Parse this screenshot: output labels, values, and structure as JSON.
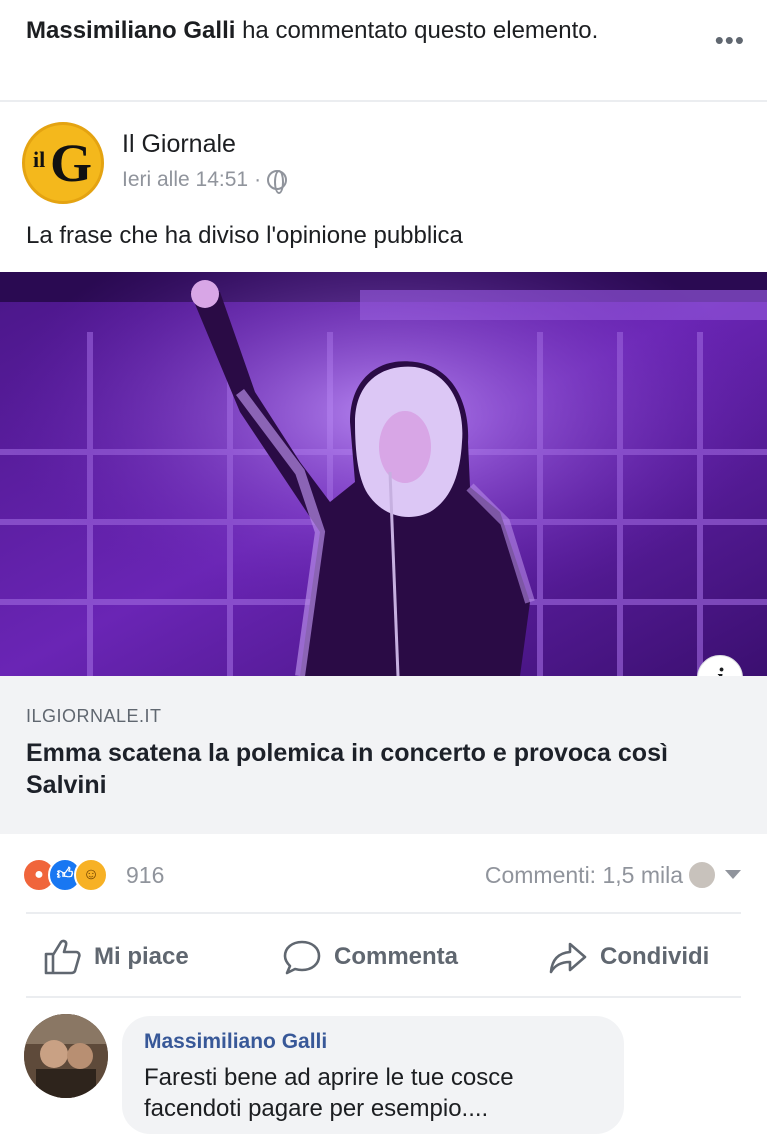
{
  "notice": {
    "actor": "Massimiliano Galli",
    "action": "ha commentato questo elemento.",
    "more_icon": "ellipsis-icon"
  },
  "post": {
    "page_name": "Il Giornale",
    "logo_letters": {
      "small": "il",
      "big": "G"
    },
    "timestamp": "Ieri alle 14:51",
    "separator": "·",
    "audience_icon": "globe-icon",
    "caption": "La frase che ha diviso l'opinione pubblica"
  },
  "link": {
    "domain": "ILGIORNALE.IT",
    "title": "Emma scatena la polemica in concerto e provoca così Salvini",
    "info_label": "i",
    "image_description_colors": {
      "stage": "#5a1e9e",
      "light": "#b07be8",
      "dark": "#26093f"
    }
  },
  "stats": {
    "reactions": [
      "angry-icon",
      "like-icon",
      "haha-icon"
    ],
    "reaction_count": "916",
    "comments": "Commenti: 1,5 mila"
  },
  "actions": {
    "like": "Mi piace",
    "comment": "Commenta",
    "share": "Condividi"
  },
  "comment": {
    "author": "Massimiliano Galli",
    "text": "Faresti bene ad aprire le tue cosce facendoti pagare per esempio...."
  },
  "colors": {
    "link_blue": "#385898",
    "meta_gray": "#90949c",
    "logo_yellow": "#f4b81c"
  }
}
